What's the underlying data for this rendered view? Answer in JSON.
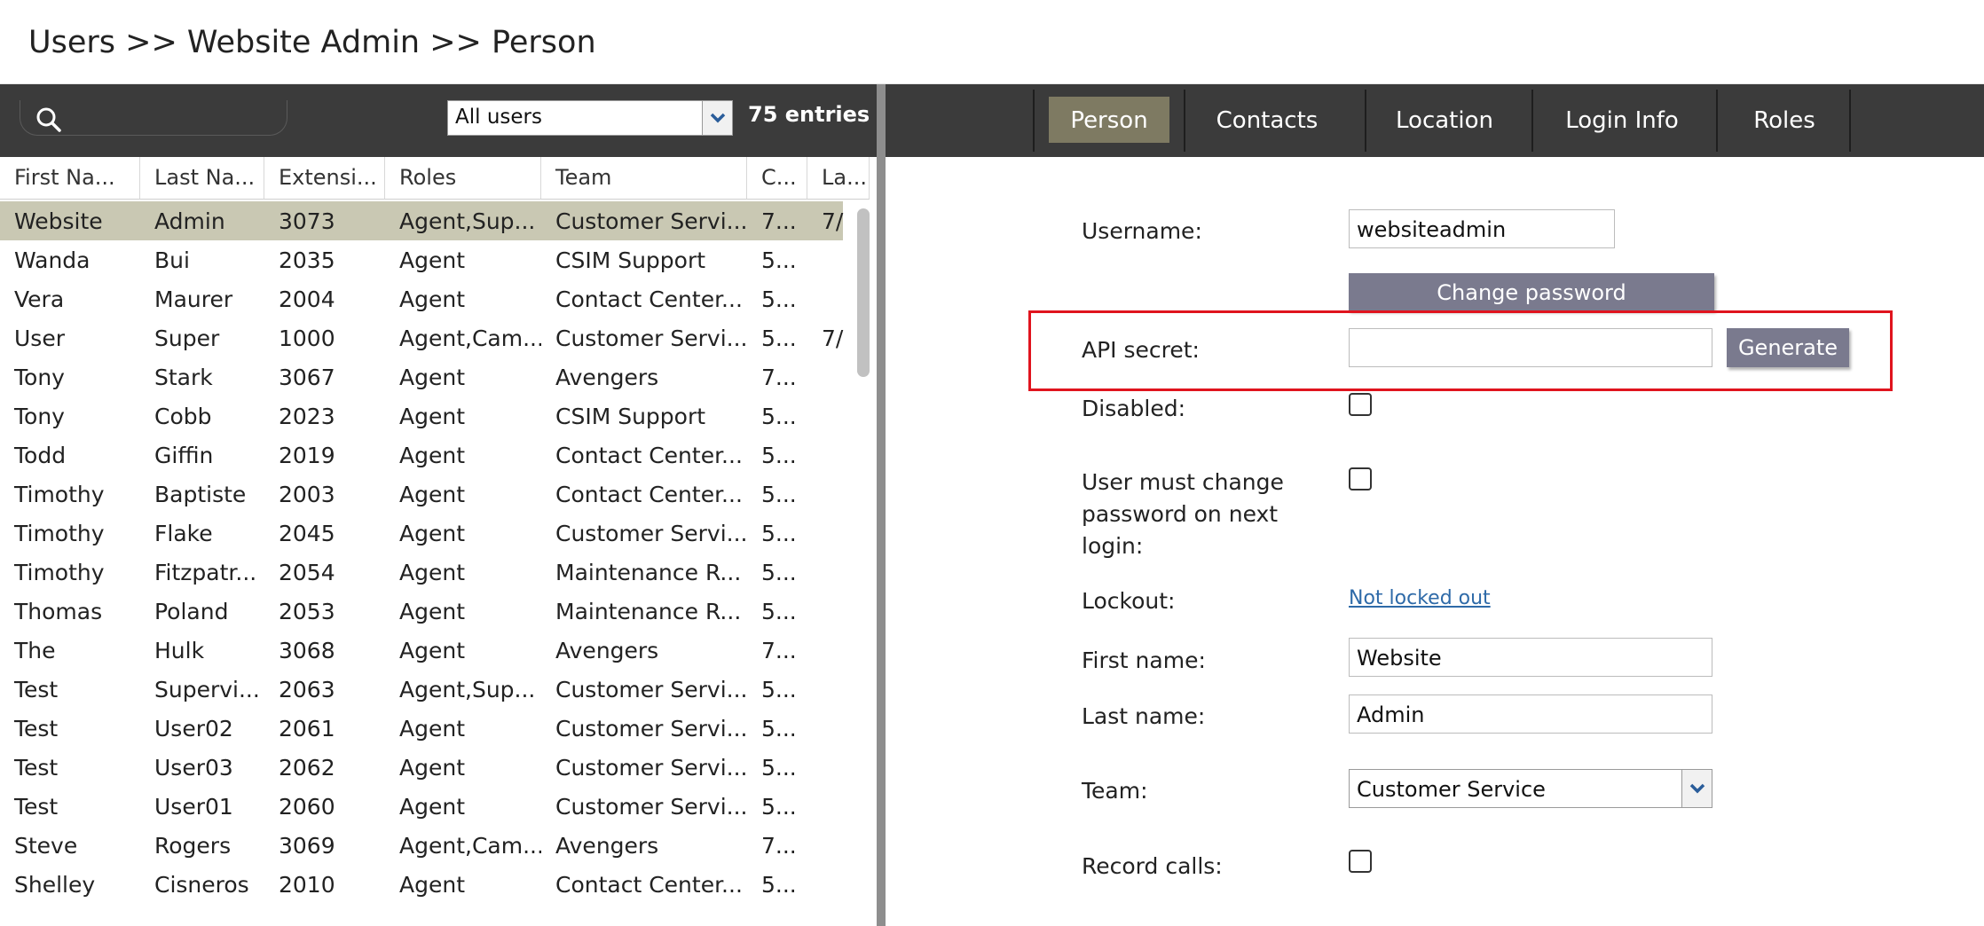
{
  "title": {
    "breadcrumb": "Users >> Website Admin >> Person"
  },
  "left_toolbar": {
    "search_placeholder": "",
    "filter_value": "All users",
    "entries": "75 entries"
  },
  "grid": {
    "columns": [
      "First Na...",
      "Last Na...",
      "Extensi...",
      "Roles",
      "Team",
      "C...",
      "La..."
    ],
    "rows": [
      [
        "Website",
        "Admin",
        "3073",
        "Agent,Sup...",
        "Customer Servi...",
        "7...",
        "7/"
      ],
      [
        "Wanda",
        "Bui",
        "2035",
        "Agent",
        "CSIM Support",
        "5...",
        ""
      ],
      [
        "Vera",
        "Maurer",
        "2004",
        "Agent",
        "Contact Center...",
        "5...",
        ""
      ],
      [
        "User",
        "Super",
        "1000",
        "Agent,Cam...",
        "Customer Servi...",
        "5...",
        "7/"
      ],
      [
        "Tony",
        "Stark",
        "3067",
        "Agent",
        "Avengers",
        "7...",
        ""
      ],
      [
        "Tony",
        "Cobb",
        "2023",
        "Agent",
        "CSIM Support",
        "5...",
        ""
      ],
      [
        "Todd",
        "Giffin",
        "2019",
        "Agent",
        "Contact Center...",
        "5...",
        ""
      ],
      [
        "Timothy",
        "Baptiste",
        "2003",
        "Agent",
        "Contact Center...",
        "5...",
        ""
      ],
      [
        "Timothy",
        "Flake",
        "2045",
        "Agent",
        "Customer Servi...",
        "5...",
        ""
      ],
      [
        "Timothy",
        "Fitzpatr...",
        "2054",
        "Agent",
        "Maintenance R...",
        "5...",
        ""
      ],
      [
        "Thomas",
        "Poland",
        "2053",
        "Agent",
        "Maintenance R...",
        "5...",
        ""
      ],
      [
        "The",
        "Hulk",
        "3068",
        "Agent",
        "Avengers",
        "7...",
        ""
      ],
      [
        "Test",
        "Supervi...",
        "2063",
        "Agent,Sup...",
        "Customer Servi...",
        "5...",
        ""
      ],
      [
        "Test",
        "User02",
        "2061",
        "Agent",
        "Customer Servi...",
        "5...",
        ""
      ],
      [
        "Test",
        "User03",
        "2062",
        "Agent",
        "Customer Servi...",
        "5...",
        ""
      ],
      [
        "Test",
        "User01",
        "2060",
        "Agent",
        "Customer Servi...",
        "5...",
        ""
      ],
      [
        "Steve",
        "Rogers",
        "3069",
        "Agent,Cam...",
        "Avengers",
        "7...",
        ""
      ],
      [
        "Shelley",
        "Cisneros",
        "2010",
        "Agent",
        "Contact Center...",
        "5...",
        ""
      ]
    ],
    "selected_row": 0
  },
  "tabs": [
    "Person",
    "Contacts",
    "Location",
    "Login Info",
    "Roles"
  ],
  "active_tab": "Person",
  "form": {
    "username_label": "Username:",
    "username_value": "websiteadmin",
    "change_password_label": "Change password",
    "api_secret_label": "API secret:",
    "api_secret_value": "",
    "generate_label": "Generate",
    "disabled_label": "Disabled:",
    "must_change_label_1": "User must change",
    "must_change_label_2": "password on next",
    "must_change_label_3": "login:",
    "lockout_label": "Lockout:",
    "lockout_value": "Not locked out",
    "first_name_label": "First name:",
    "first_name_value": "Website",
    "last_name_label": "Last name:",
    "last_name_value": "Admin",
    "team_label": "Team:",
    "team_value": "Customer Service",
    "record_calls_label": "Record calls:"
  },
  "colors": {
    "toolbar": "#3b3b3b",
    "active_tab": "#7e7a62",
    "selected_row": "#c9c8b3",
    "button": "#7a7a8e",
    "highlight_box": "#e0141e",
    "link": "#2e6aa8"
  }
}
